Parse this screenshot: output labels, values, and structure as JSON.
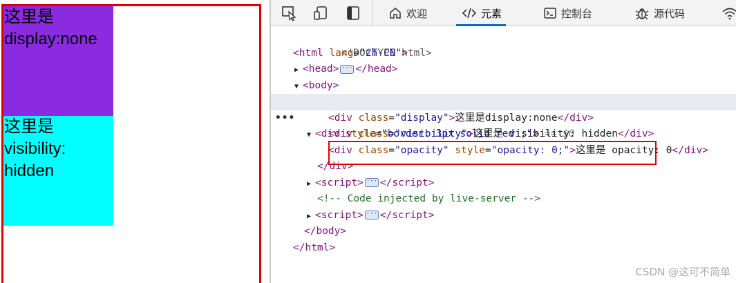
{
  "preview": {
    "display_box": {
      "lines": [
        "这里是",
        "display:none"
      ],
      "color": "#8a2be2"
    },
    "visibility_box": {
      "lines": [
        "这里是",
        "visibility:",
        "hidden"
      ],
      "color": "#00ffff"
    },
    "border_color": "#e00000"
  },
  "toolbar": {
    "icons": [
      "inspect-icon",
      "device-emulation-icon",
      "dock-sidebar-icon"
    ],
    "tabs": [
      {
        "icon": "home-icon",
        "label": "欢迎"
      },
      {
        "icon": "code-brackets-icon",
        "label": "元素",
        "active": true
      },
      {
        "icon": "console-icon",
        "label": "控制台"
      },
      {
        "icon": "bug-icon",
        "label": "源代码"
      },
      {
        "icon": "wifi-icon",
        "label": ""
      }
    ]
  },
  "dom": {
    "doctype": "<!DOCTYPE html>",
    "html_open": {
      "tag": "html",
      "attr": "lang",
      "value": "\"zh-CN\""
    },
    "head": "head",
    "body": "body",
    "div_open": {
      "tag": "div",
      "attr": "style",
      "value": "\"border: 3px solid red ;\"",
      "marker": "== $0"
    },
    "child1": {
      "tag": "div",
      "attr": "class",
      "value": "\"display\"",
      "text": "这里是display:none"
    },
    "child2": {
      "tag": "div",
      "attr": "class",
      "value": "\"visibility\"",
      "text": "这里是 visibility: hidden"
    },
    "child3": {
      "tag": "div",
      "attr": "class",
      "value": "\"opacity\"",
      "attr2": "style",
      "value2": "\"opacity: 0;\"",
      "text": "这里是 opacity: 0"
    },
    "div_close": "div",
    "script1": "script",
    "comment": "<!-- Code injected by live-server -->",
    "script2": "script",
    "body_close": "body",
    "html_close": "html",
    "gutter": "•••"
  },
  "watermark": "CSDN @这可不简单"
}
